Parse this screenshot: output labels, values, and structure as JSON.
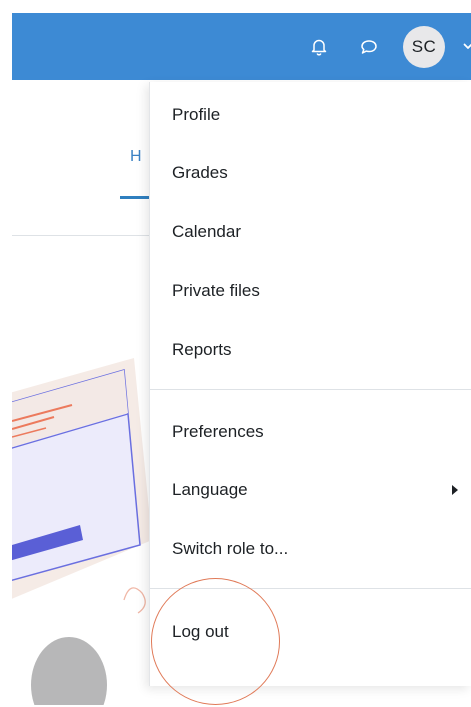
{
  "navbar": {
    "icons": {
      "notifications": "bell-icon",
      "messages": "chat-bubble-icon",
      "user_menu": "chevron-down-icon"
    },
    "user_initials": "SC",
    "color": "#3d8ad4"
  },
  "page": {
    "tab_partial_label": "H"
  },
  "user_menu": {
    "items": [
      {
        "label": "Profile"
      },
      {
        "label": "Grades"
      },
      {
        "label": "Calendar"
      },
      {
        "label": "Private files"
      },
      {
        "label": "Reports"
      },
      {
        "label": "Preferences"
      },
      {
        "label": "Language",
        "submenu_icon": "caret-right-icon"
      },
      {
        "label": "Switch role to..."
      },
      {
        "label": "Log out"
      }
    ]
  },
  "annotation": {
    "color": "#e07a58"
  }
}
